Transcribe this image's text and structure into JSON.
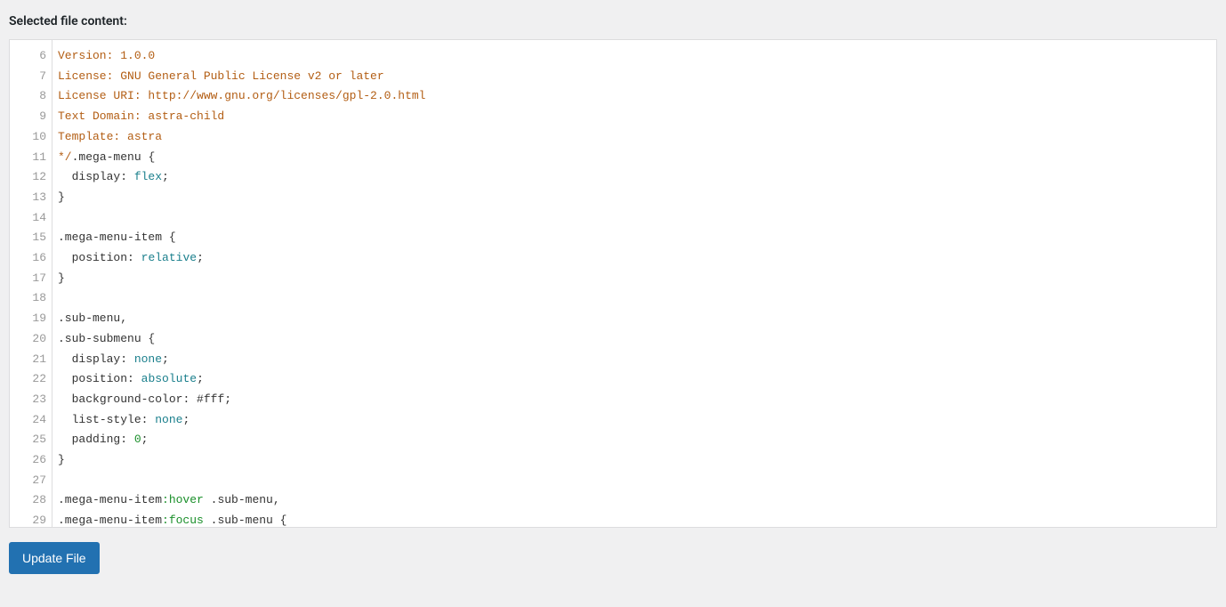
{
  "heading": "Selected file content:",
  "gutter_start": 6,
  "lines": [
    [
      [
        "c-meta",
        "Version: 1.0.0"
      ]
    ],
    [
      [
        "c-meta",
        "License: GNU General Public License v2 or later"
      ]
    ],
    [
      [
        "c-meta",
        "License URI: http://www.gnu.org/licenses/gpl-2.0.html"
      ]
    ],
    [
      [
        "c-meta",
        "Text Domain: astra-child"
      ]
    ],
    [
      [
        "c-meta",
        "Template: astra"
      ]
    ],
    [
      [
        "c-meta",
        "*/"
      ],
      [
        "c-sel",
        ".mega-menu "
      ],
      [
        "c-punc",
        "{"
      ]
    ],
    [
      [
        "plain",
        "  "
      ],
      [
        "c-prop",
        "display"
      ],
      [
        "c-punc",
        ": "
      ],
      [
        "c-kw",
        "flex"
      ],
      [
        "c-punc",
        ";"
      ]
    ],
    [
      [
        "c-punc",
        "}"
      ]
    ],
    [
      [
        "plain",
        " "
      ]
    ],
    [
      [
        "c-sel",
        ".mega-menu-item "
      ],
      [
        "c-punc",
        "{"
      ]
    ],
    [
      [
        "plain",
        "  "
      ],
      [
        "c-prop",
        "position"
      ],
      [
        "c-punc",
        ": "
      ],
      [
        "c-kw",
        "relative"
      ],
      [
        "c-punc",
        ";"
      ]
    ],
    [
      [
        "c-punc",
        "}"
      ]
    ],
    [
      [
        "plain",
        " "
      ]
    ],
    [
      [
        "c-sel",
        ".sub-menu"
      ],
      [
        "c-punc",
        ","
      ]
    ],
    [
      [
        "c-sel",
        ".sub-submenu "
      ],
      [
        "c-punc",
        "{"
      ]
    ],
    [
      [
        "plain",
        "  "
      ],
      [
        "c-prop",
        "display"
      ],
      [
        "c-punc",
        ": "
      ],
      [
        "c-kw",
        "none"
      ],
      [
        "c-punc",
        ";"
      ]
    ],
    [
      [
        "plain",
        "  "
      ],
      [
        "c-prop",
        "position"
      ],
      [
        "c-punc",
        ": "
      ],
      [
        "c-kw",
        "absolute"
      ],
      [
        "c-punc",
        ";"
      ]
    ],
    [
      [
        "plain",
        "  "
      ],
      [
        "c-prop",
        "background-color"
      ],
      [
        "c-punc",
        ": "
      ],
      [
        "c-hex",
        "#fff"
      ],
      [
        "c-punc",
        ";"
      ]
    ],
    [
      [
        "plain",
        "  "
      ],
      [
        "c-prop",
        "list-style"
      ],
      [
        "c-punc",
        ": "
      ],
      [
        "c-kw",
        "none"
      ],
      [
        "c-punc",
        ";"
      ]
    ],
    [
      [
        "plain",
        "  "
      ],
      [
        "c-prop",
        "padding"
      ],
      [
        "c-punc",
        ": "
      ],
      [
        "c-num",
        "0"
      ],
      [
        "c-punc",
        ";"
      ]
    ],
    [
      [
        "c-punc",
        "}"
      ]
    ],
    [
      [
        "plain",
        " "
      ]
    ],
    [
      [
        "c-sel",
        ".mega-menu-item"
      ],
      [
        "c-pseudo",
        ":hover"
      ],
      [
        "c-sel",
        " .sub-menu"
      ],
      [
        "c-punc",
        ","
      ]
    ],
    [
      [
        "c-sel",
        ".mega-menu-item"
      ],
      [
        "c-pseudo",
        ":focus"
      ],
      [
        "c-sel",
        " .sub-menu "
      ],
      [
        "c-punc",
        "{"
      ]
    ]
  ],
  "button_label": "Update File"
}
